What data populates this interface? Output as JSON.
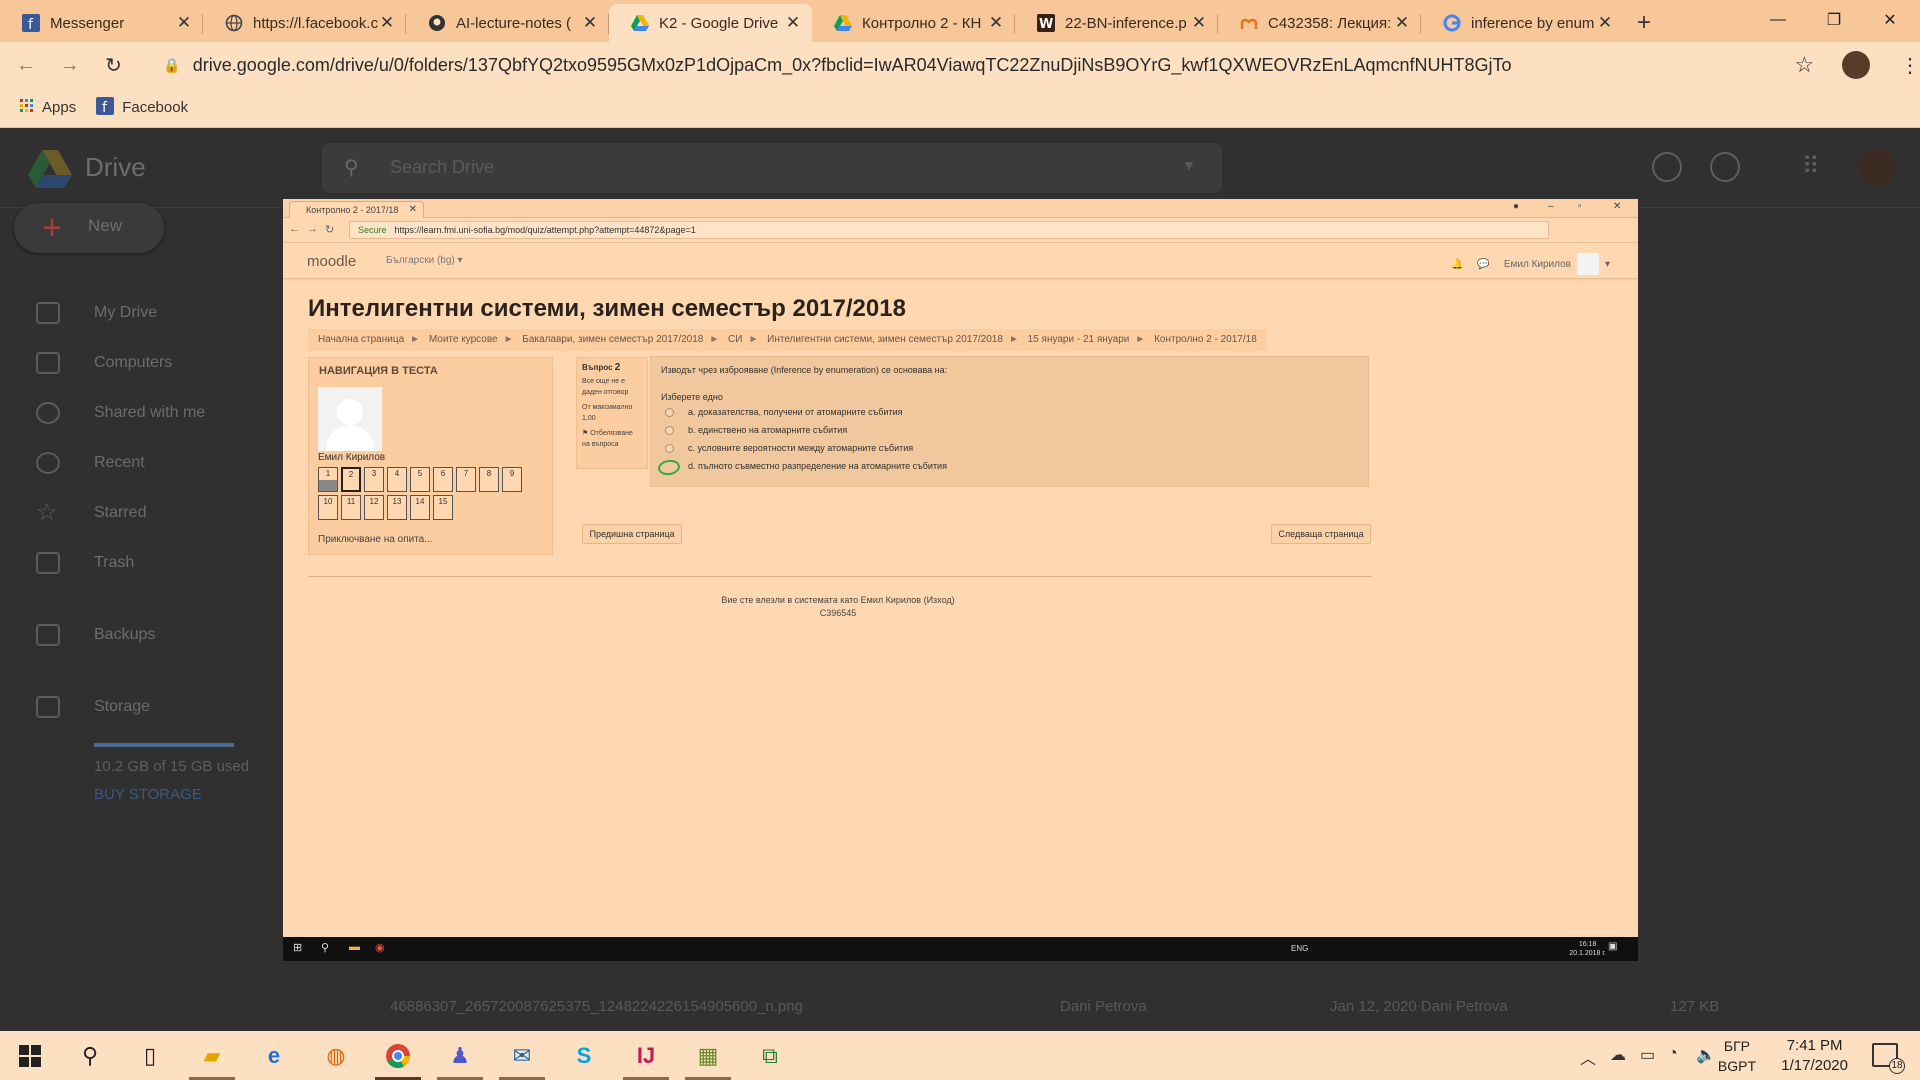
{
  "browser": {
    "tabs": [
      {
        "title": "Messenger",
        "icon": "facebook-icon"
      },
      {
        "title": "https://l.facebook.c",
        "icon": "globe-icon"
      },
      {
        "title": "AI-lecture-notes (",
        "icon": "github-icon"
      },
      {
        "title": "K2 - Google Drive",
        "icon": "google-drive-icon",
        "active": true
      },
      {
        "title": "Контролно 2 - КН",
        "icon": "google-drive-icon"
      },
      {
        "title": "22-BN-inference.p",
        "icon": "word-icon"
      },
      {
        "title": "C432358: Лекция:",
        "icon": "moodle-icon"
      },
      {
        "title": "inference by enum",
        "icon": "google-icon"
      }
    ],
    "url": "drive.google.com/drive/u/0/folders/137QbfYQ2txo9595GMx0zP1dOjpaCm_0x?fbclid=IwAR04ViawqTC22ZnuDjiNsB9OYrG_kwf1QXWEOVRzEnLAqmcnfNUHT8GjTo",
    "bookmarks": [
      {
        "label": "Apps",
        "icon": "apps-grid-icon"
      },
      {
        "label": "Facebook",
        "icon": "facebook-icon"
      }
    ]
  },
  "drive": {
    "title": "Drive",
    "search_placeholder": "Search Drive",
    "new_label": "New",
    "nav": [
      "My Drive",
      "Computers",
      "Shared with me",
      "Recent",
      "Starred",
      "Trash",
      "Backups",
      "Storage"
    ],
    "storage_text": "10.2 GB of 15 GB used",
    "buy_storage": "BUY STORAGE",
    "file_row": {
      "name": "46886307_265720087625375_1248224226154905600_n.png",
      "owner": "Dani Petrova",
      "modified": "Jan 12, 2020 Dani Petrova",
      "size": "127 KB"
    }
  },
  "screenshot": {
    "tab_title": "Контролно 2 - 2017/18",
    "url": "https://learn.fmi.uni-sofia.bg/mod/quiz/attempt.php?attempt=44872&page=1",
    "secure_label": "Secure",
    "moodle_label": "moodle",
    "language": "Български (bg)",
    "user_name": "Емил Кирилов",
    "course_title": "Интелигентни системи, зимен семестър 2017/2018",
    "breadcrumbs": [
      "Начална страница",
      "Моите курсове",
      "Бакалаври, зимен семестър 2017/2018",
      "СИ",
      "Интелигентни системи, зимен семестър 2017/2018",
      "15 януари - 21 януари",
      "Контролно 2 - 2017/18"
    ],
    "quiz_nav": {
      "title": "НАВИГАЦИЯ В ТЕСТА",
      "user": "Емил Кирилов",
      "questions": [
        "1",
        "2",
        "3",
        "4",
        "5",
        "6",
        "7",
        "8",
        "9",
        "10",
        "11",
        "12",
        "13",
        "14",
        "15"
      ],
      "answered": [
        "1"
      ],
      "current": "2",
      "finish_label": "Приключване на опита..."
    },
    "question_info": {
      "label": "Въпрос",
      "number": "2",
      "status": "Все още не е даден отговор",
      "max_points": "От максимално 1,00",
      "flag": "Отбелязване на въпроса"
    },
    "question": {
      "text": "Изводът чрез изброяване (Inference by enumeration) се основава на:",
      "prompt": "Изберете едно",
      "options": [
        "a. доказателства, получени от атомарните събития",
        "b. единствено на атомарните събития",
        "c. условните вероятности между атомарните събития",
        "d. пълното съвместно разпределение на атомарните събития"
      ]
    },
    "prev_button": "Предишна страница",
    "next_button": "Следваща страница",
    "footer_login": "Вие сте влезли в системата като Емил Кирилов (Изход)",
    "footer_code": "C396545",
    "taskbar_lang": "ENG",
    "taskbar_time": "16:18",
    "taskbar_date": "20.1.2018 г."
  },
  "taskbar": {
    "lang_top": "БГР",
    "lang_bottom": "BGPT",
    "time": "7:41 PM",
    "date": "1/17/2020",
    "notifications": "18"
  }
}
